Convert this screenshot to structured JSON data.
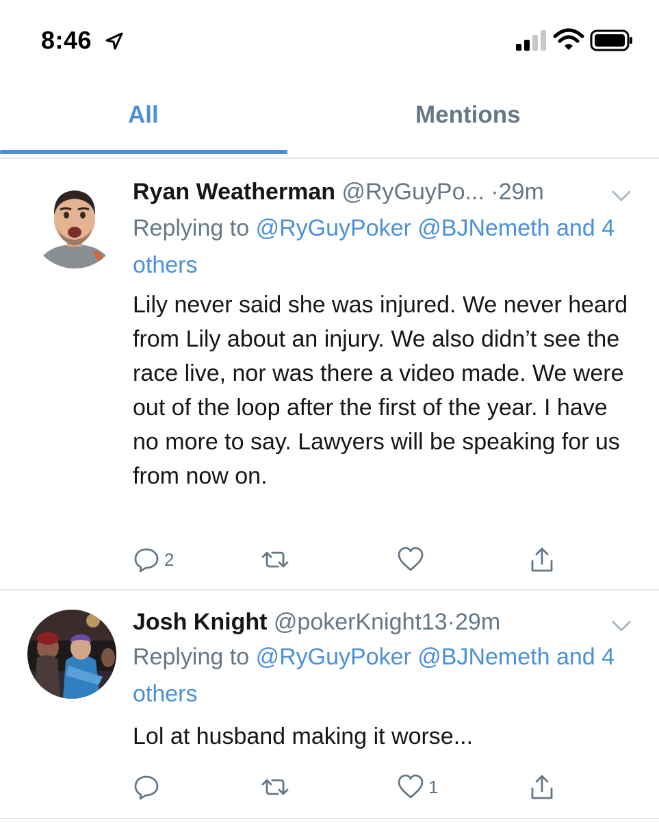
{
  "status_bar": {
    "time": "8:46",
    "icons": [
      "location-arrow-icon",
      "cellular-signal-icon",
      "wifi-icon",
      "battery-icon"
    ]
  },
  "tabs": [
    {
      "label": "All",
      "active": true
    },
    {
      "label": "Mentions",
      "active": false
    }
  ],
  "colors": {
    "accent": "#4a90d9",
    "secondary_text": "#657786",
    "primary_text": "#14171a",
    "divider": "#e1e8ed"
  },
  "tweets": [
    {
      "name": "Ryan Weatherman",
      "handle": "@RyGuyPo...",
      "separator": "·",
      "time": "29m",
      "replying_prefix": "Replying to",
      "replying_mentions": [
        "@RyGuyPoker",
        "@BJNemeth"
      ],
      "replying_others": "and 4 others",
      "text": "Lily never said she was injured. We never heard from Lily about an injury. We also didn’t see the race live, nor was there a video made. We were out of the loop after the first of the year. I have no more to say. Lawyers will be speaking for us from now on.",
      "reply_count": "2",
      "retweet_count": "",
      "like_count": ""
    },
    {
      "name": "Josh Knight",
      "handle": "@pokerKnight13",
      "separator": "·",
      "time": "29m",
      "replying_prefix": "Replying to",
      "replying_mentions": [
        "@RyGuyPoker",
        "@BJNemeth"
      ],
      "replying_others": "and 4 others",
      "text": "Lol at husband making it worse...",
      "reply_count": "",
      "retweet_count": "",
      "like_count": "1"
    }
  ]
}
